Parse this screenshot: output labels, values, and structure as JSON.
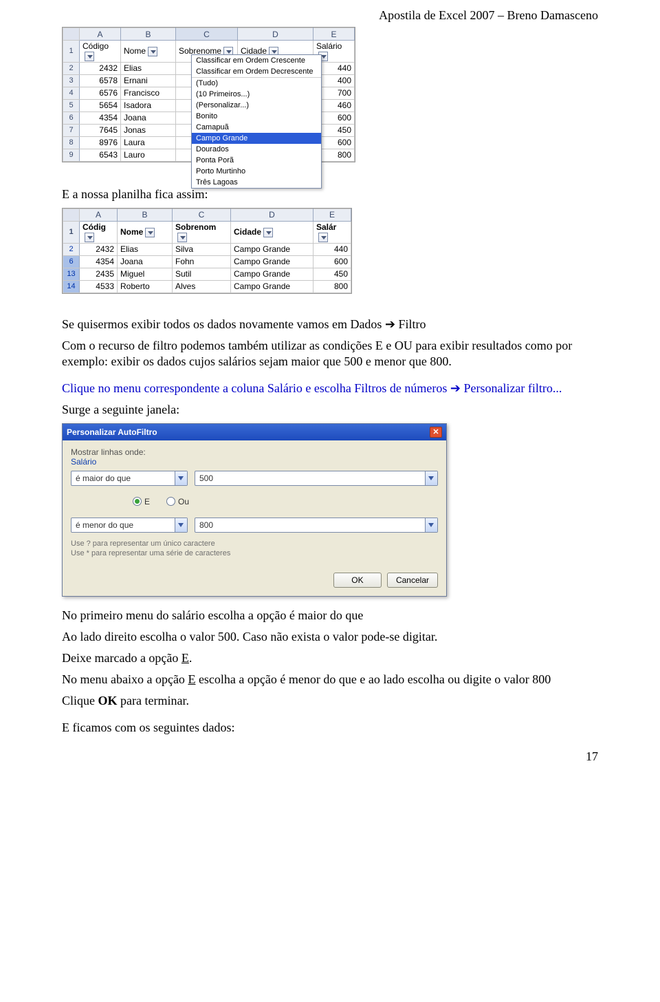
{
  "header": {
    "title": "Apostila de Excel 2007 – Breno Damasceno"
  },
  "sheet1": {
    "colLetters": [
      "A",
      "B",
      "C",
      "D",
      "E"
    ],
    "headers": [
      "Código",
      "Nome",
      "Sobrenome",
      "Cidade",
      "Salário"
    ],
    "rows": [
      {
        "n": "2",
        "c": "2432",
        "nome": "Elias",
        "sal": "440"
      },
      {
        "n": "3",
        "c": "6578",
        "nome": "Ernani",
        "sal": "400"
      },
      {
        "n": "4",
        "c": "6576",
        "nome": "Francisco",
        "sal": "700"
      },
      {
        "n": "5",
        "c": "5654",
        "nome": "Isadora",
        "sal": "460"
      },
      {
        "n": "6",
        "c": "4354",
        "nome": "Joana",
        "sal": "600"
      },
      {
        "n": "7",
        "c": "7645",
        "nome": "Jonas",
        "sal": "450"
      },
      {
        "n": "8",
        "c": "8976",
        "nome": "Laura",
        "sal": "600"
      },
      {
        "n": "9",
        "c": "6543",
        "nome": "Lauro",
        "sal": "800"
      }
    ],
    "popup": {
      "items": [
        "Classificar em Ordem Crescente",
        "Classificar em Ordem Decrescente",
        "(Tudo)",
        "(10 Primeiros...)",
        "(Personalizar...)",
        "Bonito",
        "Camapuã",
        "Campo Grande",
        "Dourados",
        "Ponta Porã",
        "Porto Murtinho",
        "Três Lagoas"
      ],
      "selected": "Campo Grande"
    }
  },
  "p1": "E a nossa planilha fica assim:",
  "sheet2": {
    "colLetters": [
      "A",
      "B",
      "C",
      "D",
      "E"
    ],
    "headers": [
      "Códig",
      "Nome",
      "Sobrenom",
      "Cidade",
      "Salár"
    ],
    "rows": [
      {
        "n": "2",
        "c": "2432",
        "nome": "Elias",
        "sob": "Silva",
        "cid": "Campo Grande",
        "sal": "440"
      },
      {
        "n": "6",
        "c": "4354",
        "nome": "Joana",
        "sob": "Fohn",
        "cid": "Campo Grande",
        "sal": "600"
      },
      {
        "n": "13",
        "c": "2435",
        "nome": "Miguel",
        "sob": "Sutil",
        "cid": "Campo Grande",
        "sal": "450"
      },
      {
        "n": "14",
        "c": "4533",
        "nome": "Roberto",
        "sob": "Alves",
        "cid": "Campo Grande",
        "sal": "800"
      }
    ]
  },
  "p2a": "Se quisermos exibir todos os dados novamente vamos em Dados ",
  "p2arrow": "➔",
  "p2b": " Filtro",
  "p3": "Com o recurso de filtro podemos também utilizar as condições E e OU para exibir resultados como por exemplo: exibir os dados cujos salários sejam maior que 500 e menor que 800.",
  "p4a": "Clique no menu correspondente a coluna Salário e escolha Filtros de números ",
  "p4b": " Personalizar filtro...",
  "p5": "Surge a seguinte janela:",
  "dialog": {
    "title": "Personalizar AutoFiltro",
    "showLinesWhere": "Mostrar linhas onde:",
    "fieldName": "Salário",
    "op1": "é maior do que",
    "val1": "500",
    "radioE": "E",
    "radioOu": "Ou",
    "op2": "é menor do que",
    "val2": "800",
    "hint1": "Use ? para representar um único caractere",
    "hint2": "Use * para representar uma série de caracteres",
    "ok": "OK",
    "cancel": "Cancelar"
  },
  "p6": "No primeiro menu do salário escolha a opção é maior do que",
  "p7": "Ao lado direito escolha o valor 500. Caso não exista o valor pode-se digitar.",
  "p8a": "Deixe marcado a opção ",
  "p8u": "E",
  "p8b": ".",
  "p9a": "No menu abaixo a opção ",
  "p9u": "E",
  "p9b": " escolha a opção é menor do que e ao lado escolha ou digite o valor 800",
  "p10a": "Clique ",
  "p10b": "OK",
  "p10c": " para terminar.",
  "p11": "E ficamos com os seguintes dados:",
  "pagenum": "17"
}
